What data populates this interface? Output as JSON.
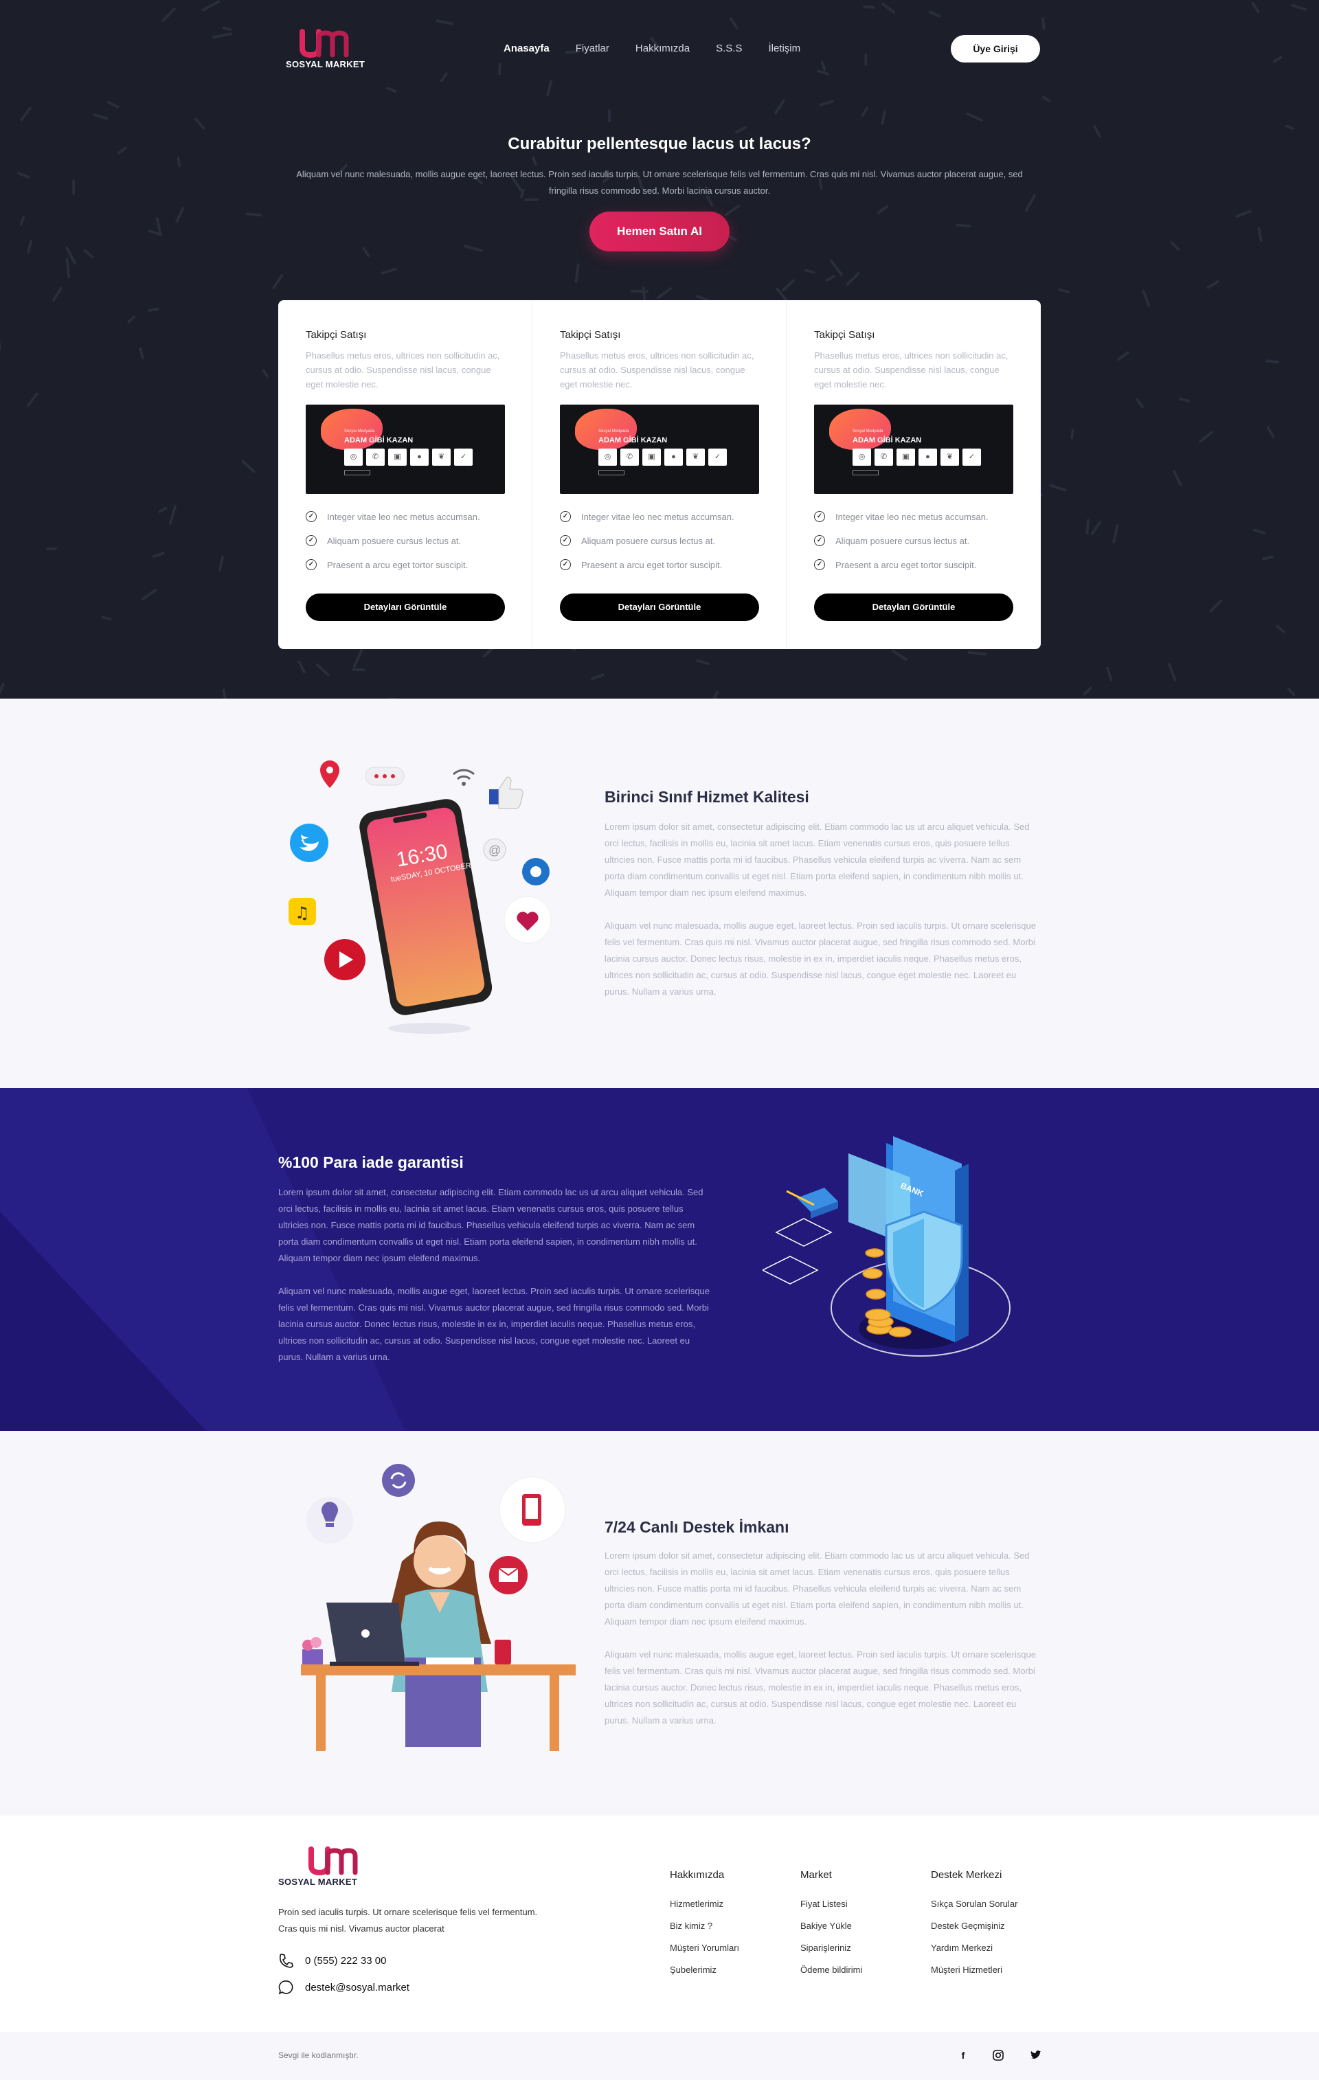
{
  "brand": {
    "name": "SOSYAL MARKET",
    "logo_color": "#e0245e"
  },
  "nav": {
    "items": [
      "Anasayfa",
      "Fiyatlar",
      "Hakkımızda",
      "S.S.S",
      "İletişim"
    ],
    "active": "Anasayfa",
    "login_label": "Üye Girişi"
  },
  "hero": {
    "title": "Curabitur pellentesque lacus ut lacus?",
    "text": "Aliquam vel nunc malesuada, mollis augue eget, laoreet lectus. Proin sed iaculis turpis. Ut ornare scelerisque felis vel fermentum. Cras quis mi nisl. Vivamus auctor placerat augue, sed fringilla risus commodo sed. Morbi lacinia cursus auctor.",
    "cta_label": "Hemen Satın Al",
    "background": "#1c1e29",
    "accent": "#e0245e"
  },
  "cards": [
    {
      "title": "Takipçi Satışı",
      "desc": "Phasellus metus eros, ultrices non sollicitudin ac, cursus at odio. Suspendisse nisl lacus, congue eget molestie nec.",
      "img_small": "Sosyal Medyada",
      "img_big": "ADAM GİBİ KAZAN",
      "features": [
        "Integer vitae leo nec metus accumsan.",
        "Aliquam posuere cursus lectus at.",
        "Praesent a arcu eget tortor suscipit."
      ],
      "button": "Detayları Görüntüle"
    },
    {
      "title": "Takipçi Satışı",
      "desc": "Phasellus metus eros, ultrices non sollicitudin ac, cursus at odio. Suspendisse nisl lacus, congue eget molestie nec.",
      "img_small": "Sosyal Medyada",
      "img_big": "ADAM GİBİ KAZAN",
      "features": [
        "Integer vitae leo nec metus accumsan.",
        "Aliquam posuere cursus lectus at.",
        "Praesent a arcu eget tortor suscipit."
      ],
      "button": "Detayları Görüntüle"
    },
    {
      "title": "Takipçi Satışı",
      "desc": "Phasellus metus eros, ultrices non sollicitudin ac, cursus at odio. Suspendisse nisl lacus, congue eget molestie nec.",
      "img_small": "Sosyal Medyada",
      "img_big": "ADAM GİBİ KAZAN",
      "features": [
        "Integer vitae leo nec metus accumsan.",
        "Aliquam posuere cursus lectus at.",
        "Praesent a arcu eget tortor suscipit."
      ],
      "button": "Detayları Görüntüle"
    }
  ],
  "section_quality": {
    "title": "Birinci Sınıf Hizmet Kalitesi",
    "p1": "Lorem ipsum dolor sit amet, consectetur adipiscing elit. Etiam commodo lac us ut arcu aliquet vehicula. Sed orci lectus, facilisis in mollis eu, lacinia sit amet lacus. Etiam venenatis cursus eros, quis posuere tellus ultricies non. Fusce mattis porta mi id faucibus. Phasellus vehicula eleifend turpis ac viverra. Nam ac sem porta diam condimentum convallis ut eget nisl. Etiam porta eleifend sapien, in condimentum nibh mollis ut. Aliquam tempor diam nec ipsum eleifend maximus.",
    "p2": "Aliquam vel nunc malesuada, mollis augue eget, laoreet lectus. Proin sed iaculis turpis. Ut ornare scelerisque felis vel fermentum. Cras quis mi nisl. Vivamus auctor placerat augue, sed fringilla risus commodo sed. Morbi lacinia cursus auctor. Donec lectus risus, molestie in ex in, imperdiet iaculis neque. Phasellus metus eros, ultrices non sollicitudin ac, cursus at odio. Suspendisse nisl lacus, congue eget molestie nec. Laoreet eu purus. Nullam a varius urna.",
    "phone_time": "16:30",
    "phone_date": "tueSDAY, 10 OCTOBER"
  },
  "section_refund": {
    "title": "%100 Para iade garantisi",
    "p1": "Lorem ipsum dolor sit amet, consectetur adipiscing elit. Etiam commodo lac us ut arcu aliquet vehicula. Sed orci lectus, facilisis in mollis eu, lacinia sit amet lacus. Etiam venenatis cursus eros, quis posuere tellus ultricies non. Fusce mattis porta mi id faucibus. Phasellus vehicula eleifend turpis ac viverra. Nam ac sem porta diam condimentum convallis ut eget nisl. Etiam porta eleifend sapien, in condimentum nibh mollis ut. Aliquam tempor diam nec ipsum eleifend maximus.",
    "p2": "Aliquam vel nunc malesuada, mollis augue eget, laoreet lectus. Proin sed iaculis turpis. Ut ornare scelerisque felis vel fermentum. Cras quis mi nisl. Vivamus auctor placerat augue, sed fringilla risus commodo sed. Morbi lacinia cursus auctor. Donec lectus risus, molestie in ex in, imperdiet iaculis neque. Phasellus metus eros, ultrices non sollicitudin ac, cursus at odio. Suspendisse nisl lacus, congue eget molestie nec. Laoreet eu purus. Nullam a varius urna.",
    "bank_label": "BANK",
    "background": "#22197a"
  },
  "section_support": {
    "title": "7/24 Canlı Destek İmkanı",
    "p1": "Lorem ipsum dolor sit amet, consectetur adipiscing elit. Etiam commodo lac us ut arcu aliquet vehicula. Sed orci lectus, facilisis in mollis eu, lacinia sit amet lacus. Etiam venenatis cursus eros, quis posuere tellus ultricies non. Fusce mattis porta mi id faucibus. Phasellus vehicula eleifend turpis ac viverra. Nam ac sem porta diam condimentum convallis ut eget nisl. Etiam porta eleifend sapien, in condimentum nibh mollis ut. Aliquam tempor diam nec ipsum eleifend maximus.",
    "p2": "Aliquam vel nunc malesuada, mollis augue eget, laoreet lectus. Proin sed iaculis turpis. Ut ornare scelerisque felis vel fermentum. Cras quis mi nisl. Vivamus auctor placerat augue, sed fringilla risus commodo sed. Morbi lacinia cursus auctor. Donec lectus risus, molestie in ex in, imperdiet iaculis neque. Phasellus metus eros, ultrices non sollicitudin ac, cursus at odio. Suspendisse nisl lacus, congue eget molestie nec. Laoreet eu purus. Nullam a varius urna."
  },
  "footer": {
    "desc": "Proin sed iaculis turpis. Ut ornare scelerisque felis vel fermentum. Cras quis mi nisl. Vivamus auctor placerat",
    "phone": "0 (555) 222 33 00",
    "email": "destek@sosyal.market",
    "columns": [
      {
        "title": "Hakkımızda",
        "items": [
          "Hizmetlerimiz",
          "Biz kimiz ?",
          "Müşteri Yorumları",
          "Şubelerimiz"
        ]
      },
      {
        "title": "Market",
        "items": [
          "Fiyat Listesi",
          "Bakiye Yükle",
          "Siparişleriniz",
          "Ödeme bildirimi"
        ]
      },
      {
        "title": "Destek Merkezi",
        "items": [
          "Sıkça Sorulan Sorular",
          "Destek Geçmişiniz",
          "Yardım Merkezi",
          "Müşteri Hizmetleri"
        ]
      }
    ],
    "copyright": "Sevgi ile kodlanmıştır.",
    "social_icons": [
      "facebook-icon",
      "instagram-icon",
      "twitter-icon"
    ]
  }
}
